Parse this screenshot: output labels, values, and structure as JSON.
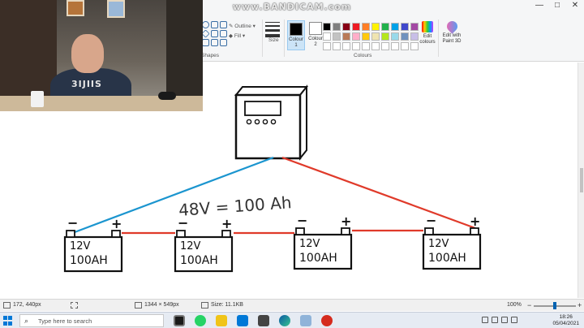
{
  "watermark": "www.BANDICAM.com",
  "window_controls": [
    "—",
    "□",
    "✕"
  ],
  "ribbon": {
    "shapes_label": "Shapes",
    "outline_label": "Outline",
    "fill_label": "Fill",
    "size_label": "Size",
    "colour1_label": "Colour 1",
    "colour2_label": "Colour 2",
    "colours_label": "Colours",
    "edit_colours_label": "Edit colours",
    "paint3d_label": "Edit with Paint 3D",
    "colour1_value": "#000000",
    "colour2_value": "#ffffff",
    "palette_row1": [
      "#000000",
      "#7f7f7f",
      "#880015",
      "#ed1c24",
      "#ff7f27",
      "#fff200",
      "#22b14c",
      "#00a2e8",
      "#3f48cc",
      "#a349a4"
    ],
    "palette_row2": [
      "#ffffff",
      "#c3c3c3",
      "#b97a57",
      "#ffaec9",
      "#ffc90e",
      "#efe4b0",
      "#b5e61d",
      "#99d9ea",
      "#7092be",
      "#c8bfe7"
    ]
  },
  "webcam": {
    "shirt_text": "3IJIIS"
  },
  "drawing": {
    "controller_buttons": 4,
    "annotation": "48V = 100 Ah",
    "wire_colors": {
      "negative": "#1b95cf",
      "positive": "#e03a2a"
    },
    "batteries": [
      {
        "voltage": "12V",
        "capacity": "100AH",
        "neg": "−",
        "pos": "+"
      },
      {
        "voltage": "12V",
        "capacity": "100AH",
        "neg": "−",
        "pos": "+"
      },
      {
        "voltage": "12V",
        "capacity": "100AH",
        "neg": "−",
        "pos": "+"
      },
      {
        "voltage": "12V",
        "capacity": "100AH",
        "neg": "−",
        "pos": "+"
      }
    ]
  },
  "statusbar": {
    "cursor_pos": "172, 440px",
    "dimensions": "1344 × 549px",
    "file_size": "Size: 11.1KB",
    "zoom": "100%",
    "zoom_level": 0.5
  },
  "taskbar": {
    "search_placeholder": "Type here to search",
    "time": "18:26",
    "date": "05/04/2021"
  }
}
